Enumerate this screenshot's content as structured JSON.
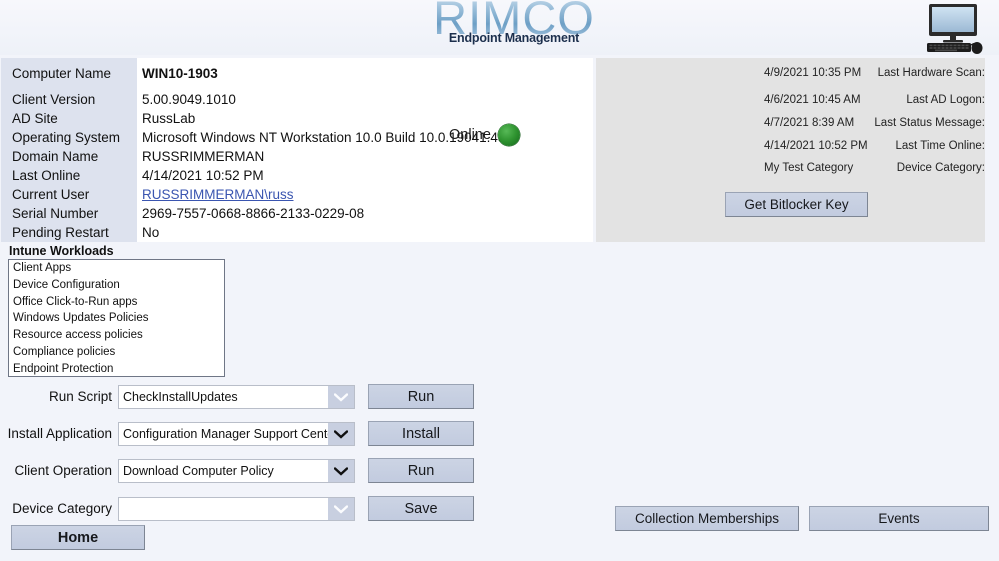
{
  "header": {
    "logo_text": "RIMCO",
    "logo_subtitle": "Endpoint Management",
    "device_icon": "desktop-computer-icon"
  },
  "device_info": {
    "rows": [
      {
        "label": "Computer Name",
        "value": "WIN10-1903",
        "bold": true,
        "link": false
      },
      {
        "label": "Client Version",
        "value": "5.00.9049.1010",
        "bold": false,
        "link": false
      },
      {
        "label": "AD Site",
        "value": "RussLab",
        "bold": false,
        "link": false
      },
      {
        "label": "Operating System",
        "value": "Microsoft Windows NT Workstation 10.0 Build 10.0.19041.450",
        "bold": false,
        "link": false
      },
      {
        "label": "Domain Name",
        "value": "RUSSRIMMERMAN",
        "bold": false,
        "link": false
      },
      {
        "label": "Last Online",
        "value": "4/14/2021 10:52 PM",
        "bold": false,
        "link": false
      },
      {
        "label": "Current User",
        "value": "RUSSRIMMERMAN\\russ",
        "bold": false,
        "link": true
      },
      {
        "label": "Serial Number",
        "value": "2969-7557-0668-8866-2133-0229-08",
        "bold": false,
        "link": false
      },
      {
        "label": "Pending Restart",
        "value": "No",
        "bold": false,
        "link": false
      }
    ],
    "status_label": "Online",
    "status_color": "#2f9430"
  },
  "scan_info": {
    "rows": [
      {
        "label": "Last Hardware Scan:",
        "value": "4/9/2021 10:35 PM"
      },
      {
        "label": "Last AD Logon:",
        "value": "4/6/2021 10:45 AM"
      },
      {
        "label": "Last Status Message:",
        "value": "4/7/2021 8:39 AM"
      },
      {
        "label": "Last Time Online:",
        "value": "4/14/2021 10:52 PM"
      },
      {
        "label": "Device Category:",
        "value": "My Test Category"
      }
    ],
    "bitlocker_button": "Get Bitlocker Key"
  },
  "workloads": {
    "title": "Intune Workloads",
    "items": [
      "Client Apps",
      "Device Configuration",
      "Office Click-to-Run apps",
      "Windows Updates Policies",
      "Resource access policies",
      "Compliance policies",
      "Endpoint Protection"
    ]
  },
  "actions": {
    "rows": [
      {
        "label": "Run Script",
        "value": "CheckInstallUpdates",
        "placeholder": "",
        "button": "Run",
        "arrow_enabled": false
      },
      {
        "label": "Install Application",
        "value": "Configuration Manager Support Center",
        "placeholder": "",
        "button": "Install",
        "arrow_enabled": true
      },
      {
        "label": "Client Operation",
        "value": "Download Computer Policy",
        "placeholder": "",
        "button": "Run",
        "arrow_enabled": true
      },
      {
        "label": "Device Category",
        "value": "",
        "placeholder": "",
        "button": "Save",
        "arrow_enabled": false
      }
    ]
  },
  "footer": {
    "home_button": "Home",
    "collections_button": "Collection Memberships",
    "events_button": "Events"
  },
  "theme": {
    "page_bg": "#f2f4fa",
    "label_col_bg": "#dde2ee",
    "panel_white": "#ffffff",
    "panel_gray": "#e3e3e3",
    "button_bg": "#c5cde0",
    "link_color": "#3a55b0"
  }
}
